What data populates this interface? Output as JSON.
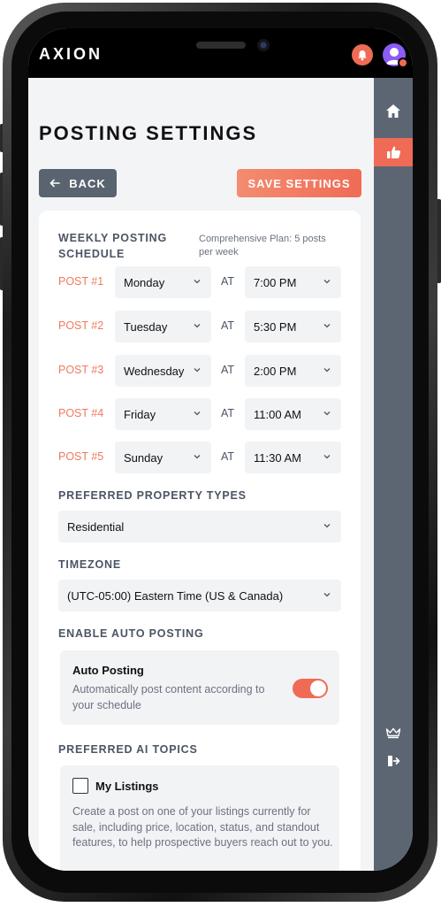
{
  "app": {
    "brand": "AXION"
  },
  "page": {
    "title": "POSTING SETTINGS"
  },
  "toolbar": {
    "back_label": "BACK",
    "save_label": "SAVE SETTINGS"
  },
  "schedule": {
    "heading": "WEEKLY POSTING SCHEDULE",
    "plan_note": "Comprehensive Plan: 5 posts per week",
    "at_label": "AT",
    "posts": [
      {
        "label": "POST #1",
        "day": "Monday",
        "time": "7:00 PM"
      },
      {
        "label": "POST #2",
        "day": "Tuesday",
        "time": "5:30 PM"
      },
      {
        "label": "POST #3",
        "day": "Wednesday",
        "time": "2:00 PM"
      },
      {
        "label": "POST #4",
        "day": "Friday",
        "time": "11:00 AM"
      },
      {
        "label": "POST #5",
        "day": "Sunday",
        "time": "11:30 AM"
      }
    ]
  },
  "property_types": {
    "heading": "PREFERRED PROPERTY TYPES",
    "value": "Residential"
  },
  "timezone": {
    "heading": "TIMEZONE",
    "value": "(UTC-05:00) Eastern Time (US & Canada)"
  },
  "auto_posting": {
    "heading": "ENABLE AUTO POSTING",
    "title": "Auto Posting",
    "description": "Automatically post content according to your schedule",
    "enabled": true
  },
  "ai_topics": {
    "heading": "PREFERRED AI TOPICS",
    "items": [
      {
        "title": "My Listings",
        "description": "Create a post on one of your listings currently for sale, including price, location, status, and standout features, to help prospective buyers reach out to you.",
        "checked": false
      }
    ]
  },
  "colors": {
    "accent": "#f06b56",
    "rail": "#5c6673",
    "back_button": "#5a6370"
  },
  "icons": [
    "bell-icon",
    "avatar",
    "home-icon",
    "thumbs-up-icon",
    "crown-icon",
    "logout-icon",
    "arrow-left-icon",
    "chevron-down-icon"
  ]
}
